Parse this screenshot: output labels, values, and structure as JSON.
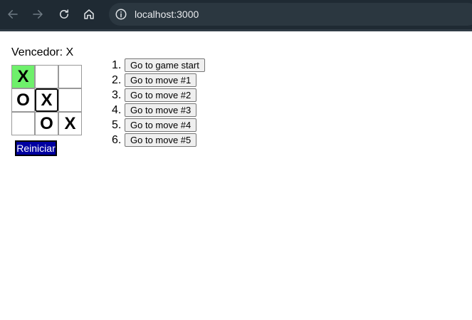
{
  "browser": {
    "url": "localhost:3000",
    "icons": {
      "back": "arrow-left-icon",
      "forward": "arrow-right-icon",
      "reload": "reload-icon",
      "home": "home-icon",
      "site_info": "info-icon"
    }
  },
  "game": {
    "status": "Vencedor: X",
    "squares": [
      "X",
      "",
      "",
      "O",
      "X",
      "",
      "",
      "O",
      "X"
    ],
    "reset_label": "Reiniciar",
    "win_color": "#6ef06b"
  },
  "moves": [
    {
      "num": "1.",
      "label": "Go to game start"
    },
    {
      "num": "2.",
      "label": "Go to move #1"
    },
    {
      "num": "3.",
      "label": "Go to move #2"
    },
    {
      "num": "4.",
      "label": "Go to move #3"
    },
    {
      "num": "5.",
      "label": "Go to move #4"
    },
    {
      "num": "6.",
      "label": "Go to move #5"
    }
  ]
}
